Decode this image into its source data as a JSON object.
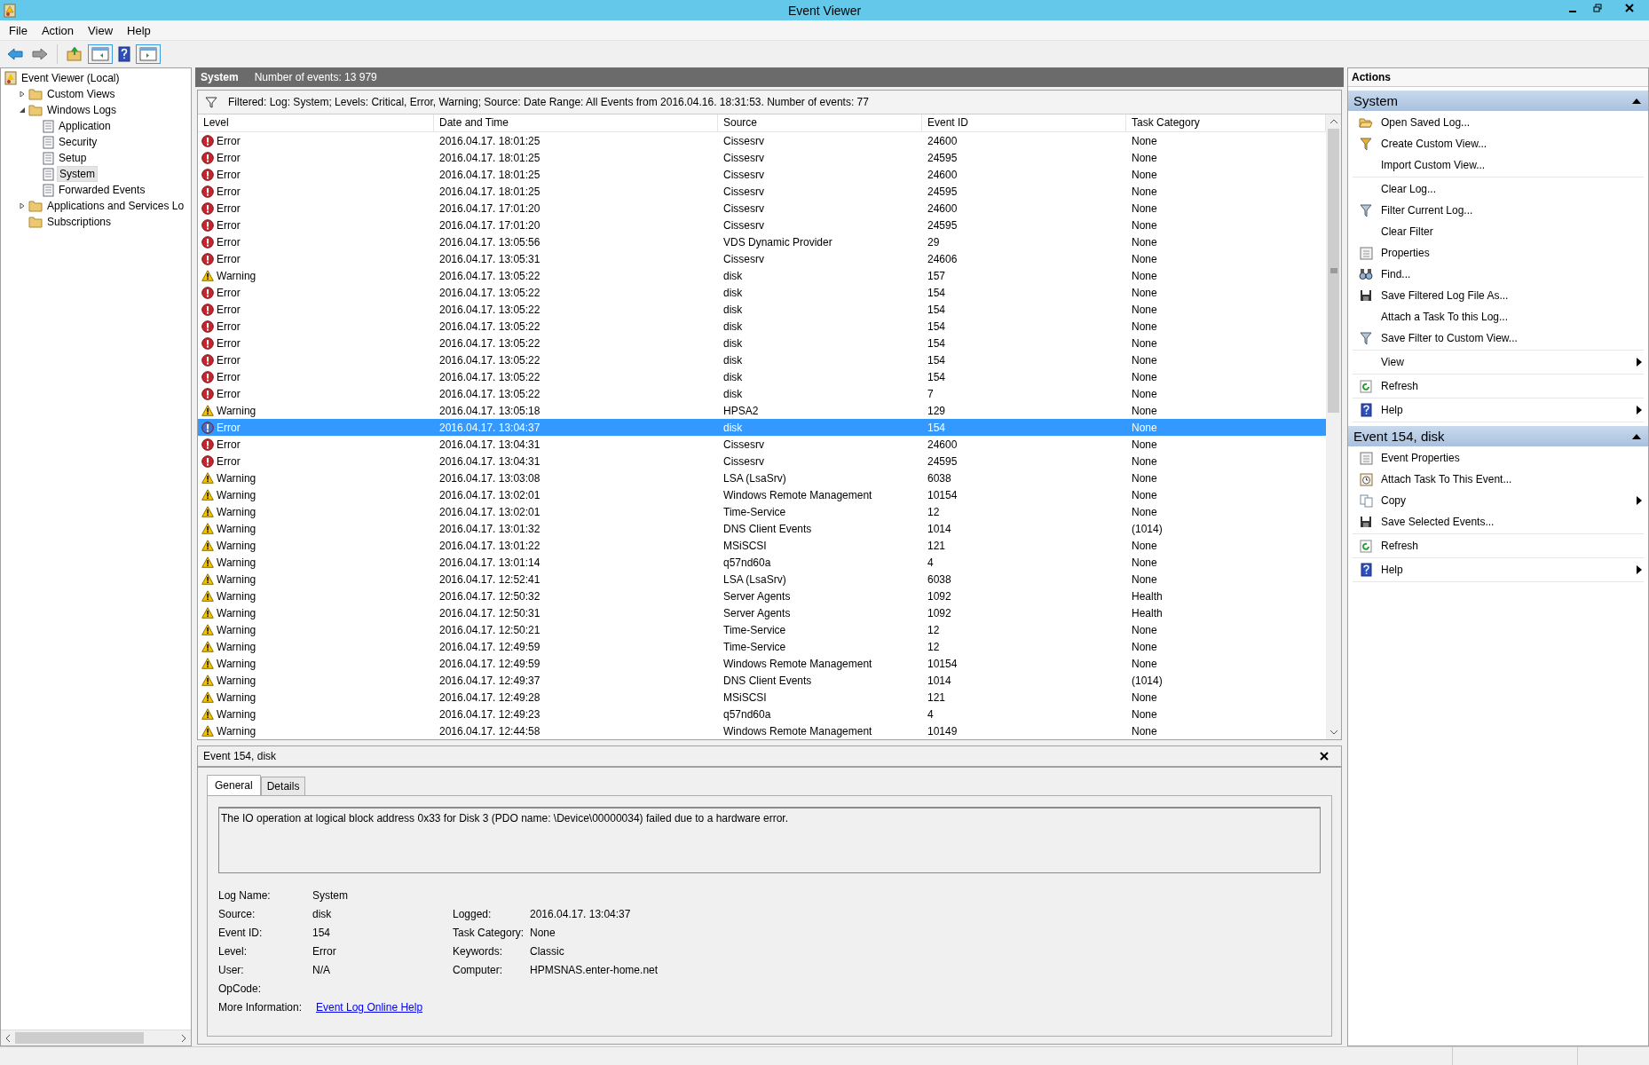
{
  "window": {
    "title": "Event Viewer"
  },
  "menu": [
    "File",
    "Action",
    "View",
    "Help"
  ],
  "tree": [
    {
      "label": "Event Viewer (Local)",
      "selected": false,
      "children": [
        {
          "label": "Custom Views",
          "selected": false,
          "expanded": false
        },
        {
          "label": "Windows Logs",
          "selected": false,
          "expanded": true,
          "children": [
            {
              "label": "Application",
              "selected": false
            },
            {
              "label": "Security",
              "selected": false
            },
            {
              "label": "Setup",
              "selected": false
            },
            {
              "label": "System",
              "selected": true
            },
            {
              "label": "Forwarded Events",
              "selected": false
            }
          ]
        },
        {
          "label": "Applications and Services Lo",
          "selected": false,
          "expanded": false
        },
        {
          "label": "Subscriptions",
          "selected": false
        }
      ]
    }
  ],
  "log_header": {
    "name": "System",
    "count": "Number of events: 13 979"
  },
  "filter": "Filtered: Log: System; Levels: Critical, Error, Warning; Source: Date Range: All Events from 2016.04.16. 18:31:53. Number of events: 77",
  "table": {
    "columns": [
      "Level",
      "Date and Time",
      "Source",
      "Event ID",
      "Task Category"
    ],
    "rows": [
      {
        "kind": "error",
        "level": "Error",
        "date": "2016.04.17. 18:01:25",
        "source": "Cissesrv",
        "id": "24600",
        "category": "None",
        "selected": false
      },
      {
        "kind": "error",
        "level": "Error",
        "date": "2016.04.17. 18:01:25",
        "source": "Cissesrv",
        "id": "24595",
        "category": "None",
        "selected": false
      },
      {
        "kind": "error",
        "level": "Error",
        "date": "2016.04.17. 18:01:25",
        "source": "Cissesrv",
        "id": "24600",
        "category": "None",
        "selected": false
      },
      {
        "kind": "error",
        "level": "Error",
        "date": "2016.04.17. 18:01:25",
        "source": "Cissesrv",
        "id": "24595",
        "category": "None",
        "selected": false
      },
      {
        "kind": "error",
        "level": "Error",
        "date": "2016.04.17. 17:01:20",
        "source": "Cissesrv",
        "id": "24600",
        "category": "None",
        "selected": false
      },
      {
        "kind": "error",
        "level": "Error",
        "date": "2016.04.17. 17:01:20",
        "source": "Cissesrv",
        "id": "24595",
        "category": "None",
        "selected": false
      },
      {
        "kind": "error",
        "level": "Error",
        "date": "2016.04.17. 13:05:56",
        "source": "VDS Dynamic Provider",
        "id": "29",
        "category": "None",
        "selected": false
      },
      {
        "kind": "error",
        "level": "Error",
        "date": "2016.04.17. 13:05:31",
        "source": "Cissesrv",
        "id": "24606",
        "category": "None",
        "selected": false
      },
      {
        "kind": "warning",
        "level": "Warning",
        "date": "2016.04.17. 13:05:22",
        "source": "disk",
        "id": "157",
        "category": "None",
        "selected": false
      },
      {
        "kind": "error",
        "level": "Error",
        "date": "2016.04.17. 13:05:22",
        "source": "disk",
        "id": "154",
        "category": "None",
        "selected": false
      },
      {
        "kind": "error",
        "level": "Error",
        "date": "2016.04.17. 13:05:22",
        "source": "disk",
        "id": "154",
        "category": "None",
        "selected": false
      },
      {
        "kind": "error",
        "level": "Error",
        "date": "2016.04.17. 13:05:22",
        "source": "disk",
        "id": "154",
        "category": "None",
        "selected": false
      },
      {
        "kind": "error",
        "level": "Error",
        "date": "2016.04.17. 13:05:22",
        "source": "disk",
        "id": "154",
        "category": "None",
        "selected": false
      },
      {
        "kind": "error",
        "level": "Error",
        "date": "2016.04.17. 13:05:22",
        "source": "disk",
        "id": "154",
        "category": "None",
        "selected": false
      },
      {
        "kind": "error",
        "level": "Error",
        "date": "2016.04.17. 13:05:22",
        "source": "disk",
        "id": "154",
        "category": "None",
        "selected": false
      },
      {
        "kind": "error",
        "level": "Error",
        "date": "2016.04.17. 13:05:22",
        "source": "disk",
        "id": "7",
        "category": "None",
        "selected": false
      },
      {
        "kind": "warning",
        "level": "Warning",
        "date": "2016.04.17. 13:05:18",
        "source": "HPSA2",
        "id": "129",
        "category": "None",
        "selected": false
      },
      {
        "kind": "error",
        "level": "Error",
        "date": "2016.04.17. 13:04:37",
        "source": "disk",
        "id": "154",
        "category": "None",
        "selected": true
      },
      {
        "kind": "error",
        "level": "Error",
        "date": "2016.04.17. 13:04:31",
        "source": "Cissesrv",
        "id": "24600",
        "category": "None",
        "selected": false
      },
      {
        "kind": "error",
        "level": "Error",
        "date": "2016.04.17. 13:04:31",
        "source": "Cissesrv",
        "id": "24595",
        "category": "None",
        "selected": false
      },
      {
        "kind": "warning",
        "level": "Warning",
        "date": "2016.04.17. 13:03:08",
        "source": "LSA (LsaSrv)",
        "id": "6038",
        "category": "None",
        "selected": false
      },
      {
        "kind": "warning",
        "level": "Warning",
        "date": "2016.04.17. 13:02:01",
        "source": "Windows Remote Management",
        "id": "10154",
        "category": "None",
        "selected": false
      },
      {
        "kind": "warning",
        "level": "Warning",
        "date": "2016.04.17. 13:02:01",
        "source": "Time-Service",
        "id": "12",
        "category": "None",
        "selected": false
      },
      {
        "kind": "warning",
        "level": "Warning",
        "date": "2016.04.17. 13:01:32",
        "source": "DNS Client Events",
        "id": "1014",
        "category": "(1014)",
        "selected": false
      },
      {
        "kind": "warning",
        "level": "Warning",
        "date": "2016.04.17. 13:01:22",
        "source": "MSiSCSI",
        "id": "121",
        "category": "None",
        "selected": false
      },
      {
        "kind": "warning",
        "level": "Warning",
        "date": "2016.04.17. 13:01:14",
        "source": "q57nd60a",
        "id": "4",
        "category": "None",
        "selected": false
      },
      {
        "kind": "warning",
        "level": "Warning",
        "date": "2016.04.17. 12:52:41",
        "source": "LSA (LsaSrv)",
        "id": "6038",
        "category": "None",
        "selected": false
      },
      {
        "kind": "warning",
        "level": "Warning",
        "date": "2016.04.17. 12:50:32",
        "source": "Server Agents",
        "id": "1092",
        "category": "Health",
        "selected": false
      },
      {
        "kind": "warning",
        "level": "Warning",
        "date": "2016.04.17. 12:50:31",
        "source": "Server Agents",
        "id": "1092",
        "category": "Health",
        "selected": false
      },
      {
        "kind": "warning",
        "level": "Warning",
        "date": "2016.04.17. 12:50:21",
        "source": "Time-Service",
        "id": "12",
        "category": "None",
        "selected": false
      },
      {
        "kind": "warning",
        "level": "Warning",
        "date": "2016.04.17. 12:49:59",
        "source": "Time-Service",
        "id": "12",
        "category": "None",
        "selected": false
      },
      {
        "kind": "warning",
        "level": "Warning",
        "date": "2016.04.17. 12:49:59",
        "source": "Windows Remote Management",
        "id": "10154",
        "category": "None",
        "selected": false
      },
      {
        "kind": "warning",
        "level": "Warning",
        "date": "2016.04.17. 12:49:37",
        "source": "DNS Client Events",
        "id": "1014",
        "category": "(1014)",
        "selected": false
      },
      {
        "kind": "warning",
        "level": "Warning",
        "date": "2016.04.17. 12:49:28",
        "source": "MSiSCSI",
        "id": "121",
        "category": "None",
        "selected": false
      },
      {
        "kind": "warning",
        "level": "Warning",
        "date": "2016.04.17. 12:49:23",
        "source": "q57nd60a",
        "id": "4",
        "category": "None",
        "selected": false
      },
      {
        "kind": "warning",
        "level": "Warning",
        "date": "2016.04.17. 12:44:58",
        "source": "Windows Remote Management",
        "id": "10149",
        "category": "None",
        "selected": false
      }
    ]
  },
  "details": {
    "title": "Event 154, disk",
    "tabs": [
      {
        "label": "General",
        "selected": true
      },
      {
        "label": "Details",
        "selected": false
      }
    ],
    "message": "The IO operation at logical block address 0x33 for Disk 3 (PDO name: \\Device\\00000034) failed due to a hardware error.",
    "fields_left": [
      {
        "label": "Log Name:",
        "value": "System"
      },
      {
        "label": "Source:",
        "value": "disk"
      },
      {
        "label": "Event ID:",
        "value": "154"
      },
      {
        "label": "Level:",
        "value": "Error"
      },
      {
        "label": "User:",
        "value": "N/A"
      },
      {
        "label": "OpCode:"
      }
    ],
    "fields_right": [
      {
        "label": "Logged:",
        "value": "2016.04.17. 13:04:37"
      },
      {
        "label": "Task Category:",
        "value": "None"
      },
      {
        "label": "Keywords:",
        "value": "Classic"
      },
      {
        "label": "Computer:",
        "value": "HPMSNAS.enter-home.net"
      }
    ],
    "more_info": {
      "label": "More Information:",
      "link": "Event Log Online Help"
    }
  },
  "actions": {
    "title": "Actions",
    "sections": [
      {
        "title": "System",
        "groups": [
          [
            {
              "label": "Open Saved Log...",
              "kind": "open"
            },
            {
              "label": "Create Custom View...",
              "kind": "funnel"
            },
            {
              "label": "Import Custom View...",
              "kind": "none"
            }
          ],
          [
            {
              "label": "Clear Log...",
              "kind": "none"
            },
            {
              "label": "Filter Current Log...",
              "kind": "filter"
            },
            {
              "label": "Clear Filter",
              "kind": "none"
            },
            {
              "label": "Properties",
              "kind": "properties"
            },
            {
              "label": "Find...",
              "kind": "find"
            },
            {
              "label": "Save Filtered Log File As...",
              "kind": "save"
            },
            {
              "label": "Attach a Task To this Log...",
              "kind": "none"
            },
            {
              "label": "Save Filter to Custom View...",
              "kind": "filter"
            }
          ],
          [
            {
              "label": "View",
              "kind": "none",
              "submenu": true
            }
          ],
          [
            {
              "label": "Refresh",
              "kind": "refresh"
            }
          ],
          [
            {
              "label": "Help",
              "kind": "help",
              "submenu": true
            }
          ]
        ]
      },
      {
        "title": "Event 154, disk",
        "groups": [
          [
            {
              "label": "Event Properties",
              "kind": "properties"
            },
            {
              "label": "Attach Task To This Event...",
              "kind": "task"
            },
            {
              "label": "Copy",
              "kind": "copy",
              "submenu": true
            },
            {
              "label": "Save Selected Events...",
              "kind": "save"
            }
          ],
          [
            {
              "label": "Refresh",
              "kind": "refresh"
            }
          ],
          [
            {
              "label": "Help",
              "kind": "help",
              "submenu": true
            }
          ]
        ]
      }
    ]
  }
}
